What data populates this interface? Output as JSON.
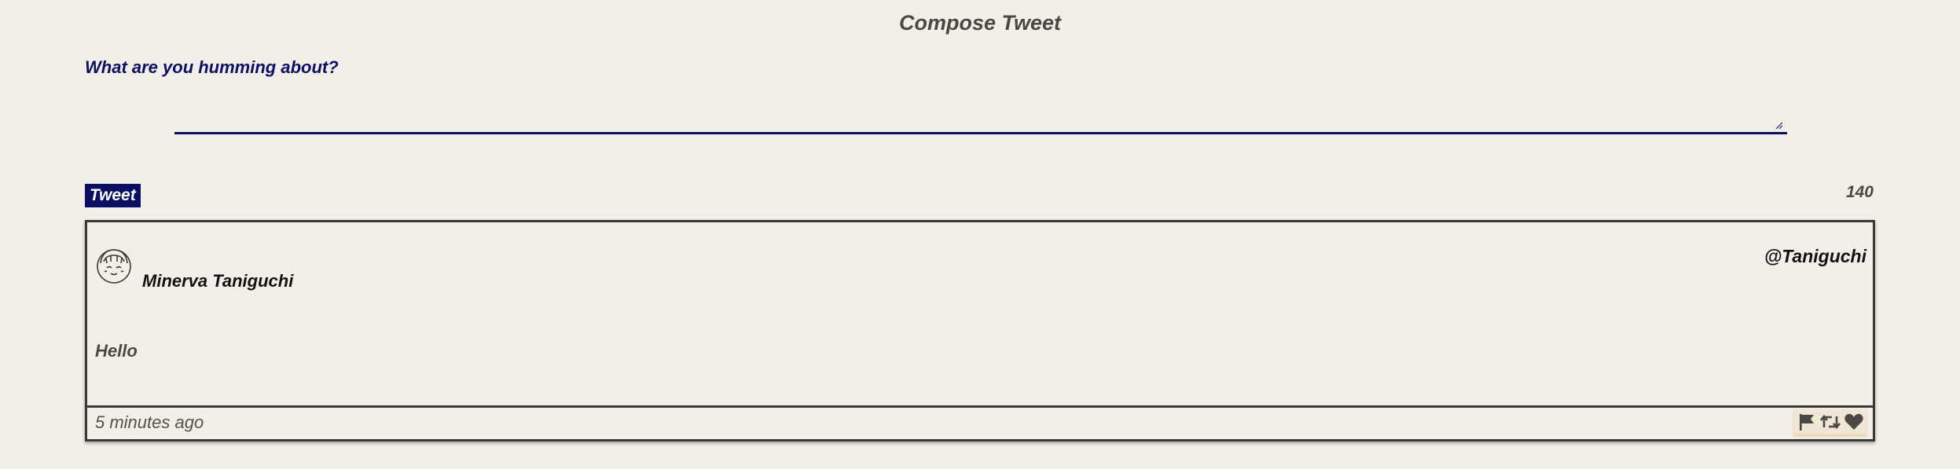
{
  "header": {
    "title": "Compose Tweet"
  },
  "compose": {
    "prompt": "What are you humming about?",
    "input_value": "",
    "tweet_button_label": "Tweet",
    "char_count": "140"
  },
  "tweet": {
    "author_name": "Minerva Taniguchi",
    "handle": "@Taniguchi",
    "text": "Hello",
    "timestamp": "5 minutes ago",
    "avatar_icon": "girl-face-icon",
    "actions": [
      {
        "icon": "flag-icon"
      },
      {
        "icon": "retweet-icon"
      },
      {
        "icon": "heart-icon"
      }
    ]
  },
  "colors": {
    "background": "#f2efe8",
    "accent": "#0b0f63",
    "text_muted": "#4a4843",
    "border": "#3b3935"
  }
}
